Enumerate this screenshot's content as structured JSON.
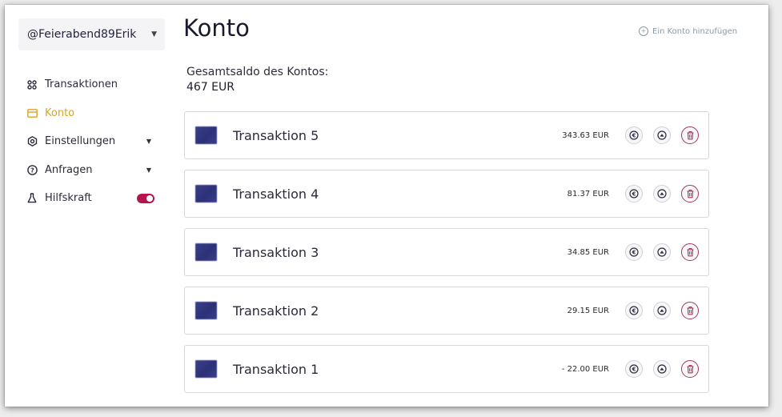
{
  "sidebar": {
    "account_name": "@Feierabend89Erik",
    "items": [
      {
        "label": "Transaktionen",
        "icon": "grid-icon",
        "active": false
      },
      {
        "label": "Konto",
        "icon": "card-icon",
        "active": true
      },
      {
        "label": "Einstellungen",
        "icon": "gear-icon",
        "active": false,
        "expandable": true
      },
      {
        "label": "Anfragen",
        "icon": "question-icon",
        "active": false,
        "expandable": true
      },
      {
        "label": "Hilfskraft",
        "icon": "flask-icon",
        "active": false,
        "toggle_on": true
      }
    ]
  },
  "main": {
    "title": "Konto",
    "add_account_label": "Ein Konto hinzufügen",
    "balance_label": "Gesamtsaldo des Kontos:",
    "balance_value": "467 EUR",
    "transactions": [
      {
        "name": "Transaktion 5",
        "amount": "343.63 EUR"
      },
      {
        "name": "Transaktion 4",
        "amount": "81.37 EUR"
      },
      {
        "name": "Transaktion 3",
        "amount": "34.85 EUR"
      },
      {
        "name": "Transaktion 2",
        "amount": "29.15 EUR"
      },
      {
        "name": "Transaktion 1",
        "amount": "- 22.00 EUR"
      }
    ]
  },
  "colors": {
    "accent": "#d9a329",
    "toggle": "#b4154f",
    "delete_border": "#a3355f",
    "thumb": "#2c3178"
  }
}
